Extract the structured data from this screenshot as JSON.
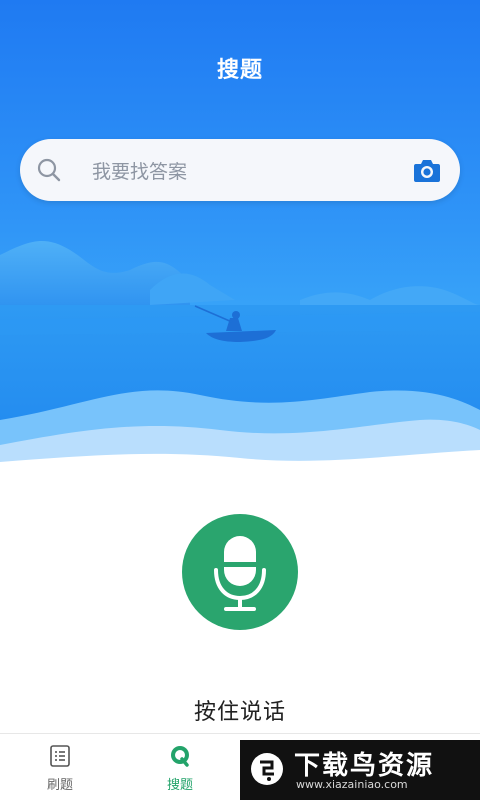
{
  "header": {
    "title": "搜题"
  },
  "search": {
    "placeholder": "我要找答案"
  },
  "voice": {
    "label": "按住说话"
  },
  "tabs": [
    {
      "label": "刷题",
      "active": false
    },
    {
      "label": "搜题",
      "active": true
    }
  ],
  "watermark": {
    "text": "下载鸟资源",
    "url": "www.xiazainiao.com"
  },
  "colors": {
    "primary_blue": "#2f94f7",
    "accent_green": "#2aa56e",
    "active_tab": "#23a36a"
  }
}
